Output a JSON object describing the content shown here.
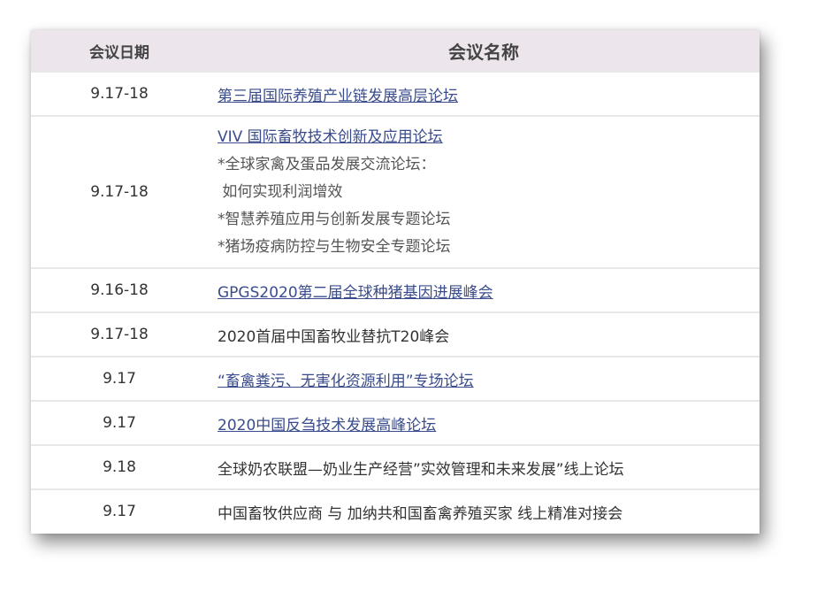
{
  "table": {
    "headers": {
      "date": "会议日期",
      "name": "会议名称"
    },
    "rows": [
      {
        "date": "9.17-18",
        "title": "第三届国际养殖产业链发展高层论坛",
        "link": true
      },
      {
        "date": "9.17-18",
        "title": "VIV 国际畜牧技术创新及应用论坛",
        "link": true,
        "sub": [
          "*全球家禽及蛋品发展交流论坛：",
          " 如何实现利润增效",
          "*智慧养殖应用与创新发展专题论坛",
          "*猪场疫病防控与生物安全专题论坛"
        ]
      },
      {
        "date": "9.16-18",
        "title": "GPGS2020第二届全球种猪基因进展峰会",
        "link": true
      },
      {
        "date": "9.17-18",
        "title": "2020首届中国畜牧业替抗T20峰会",
        "link": false
      },
      {
        "date": "9.17",
        "title": "“畜禽粪污、无害化资源利用”专场论坛",
        "link": true
      },
      {
        "date": "9.17",
        "title": "2020中国反刍技术发展高峰论坛",
        "link": true
      },
      {
        "date": "9.18",
        "title": "全球奶农联盟—奶业生产经营”实效管理和未来发展”线上论坛",
        "link": false
      },
      {
        "date": "9.17",
        "title": "中国畜牧供应商 与 加纳共和国畜禽养殖买家 线上精准对接会",
        "link": false
      }
    ]
  },
  "colors": {
    "header_bg": "#ece5ec",
    "link": "#3a4c8c",
    "text": "#333333"
  }
}
